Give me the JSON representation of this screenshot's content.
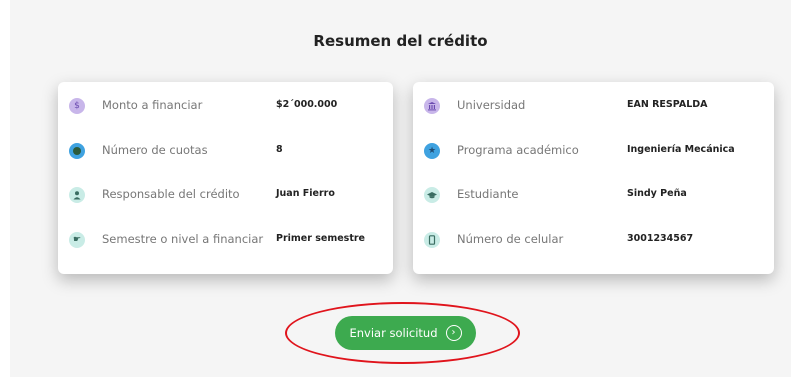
{
  "title": "Resumen del crédito",
  "left_card": [
    {
      "icon": "dollar-icon",
      "label": "Monto a financiar",
      "value": "$2´000.000"
    },
    {
      "icon": "coins-icon",
      "label": "Número de cuotas",
      "value": "8"
    },
    {
      "icon": "person-icon",
      "label": "Responsable del  crédito",
      "value": "Juan Fierro"
    },
    {
      "icon": "pointing-hand-icon",
      "label": "Semestre o nivel a financiar",
      "value": "Primer semestre"
    }
  ],
  "right_card": [
    {
      "icon": "university-building-icon",
      "label": "Universidad",
      "value": "EAN RESPALDA"
    },
    {
      "icon": "star-icon",
      "label": "Programa académico",
      "value": "Ingeniería Mecánica"
    },
    {
      "icon": "graduation-cap-icon",
      "label": "Estudiante",
      "value": "Sindy Peña"
    },
    {
      "icon": "mobile-phone-icon",
      "label": "Número de celular",
      "value": "3001234567"
    }
  ],
  "submit": {
    "label": "Enviar solicitud",
    "icon": "chevron-right-circle-icon"
  },
  "colors": {
    "accent_green": "#3daa4f",
    "highlight_red": "#e0141c"
  }
}
